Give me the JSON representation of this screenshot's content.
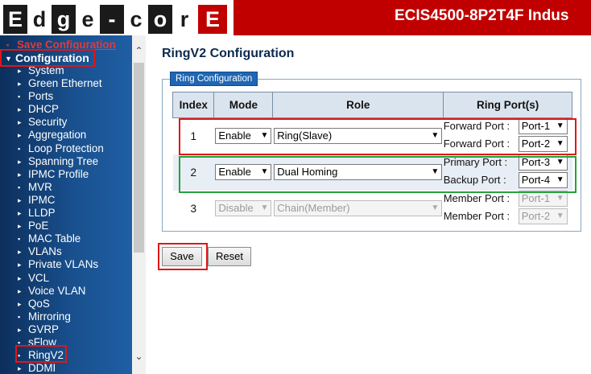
{
  "header": {
    "logo_letters": [
      "E",
      "d",
      "g",
      "e",
      "-",
      "c",
      "o",
      "r",
      "E"
    ],
    "device_title": "ECIS4500-8P2T4F Indus"
  },
  "sidebar": {
    "save_configuration": "Save Configuration",
    "configuration": "Configuration",
    "items": [
      {
        "label": "System",
        "marker": "▸"
      },
      {
        "label": "Green Ethernet",
        "marker": "▸"
      },
      {
        "label": "Ports",
        "marker": "▪"
      },
      {
        "label": "DHCP",
        "marker": "▸"
      },
      {
        "label": "Security",
        "marker": "▸"
      },
      {
        "label": "Aggregation",
        "marker": "▸"
      },
      {
        "label": "Loop Protection",
        "marker": "▪"
      },
      {
        "label": "Spanning Tree",
        "marker": "▸"
      },
      {
        "label": "IPMC Profile",
        "marker": "▸"
      },
      {
        "label": "MVR",
        "marker": "▪"
      },
      {
        "label": "IPMC",
        "marker": "▸"
      },
      {
        "label": "LLDP",
        "marker": "▸"
      },
      {
        "label": "PoE",
        "marker": "▸"
      },
      {
        "label": "MAC Table",
        "marker": "▪"
      },
      {
        "label": "VLANs",
        "marker": "▸"
      },
      {
        "label": "Private VLANs",
        "marker": "▸"
      },
      {
        "label": "VCL",
        "marker": "▸"
      },
      {
        "label": "Voice VLAN",
        "marker": "▸"
      },
      {
        "label": "QoS",
        "marker": "▸"
      },
      {
        "label": "Mirroring",
        "marker": "▪"
      },
      {
        "label": "GVRP",
        "marker": "▸"
      },
      {
        "label": "sFlow",
        "marker": "▪"
      },
      {
        "label": "RingV2",
        "marker": "▪"
      },
      {
        "label": "DDMI",
        "marker": "▸"
      }
    ]
  },
  "main": {
    "title": "RingV2 Configuration",
    "legend": "Ring Configuration",
    "columns": [
      "Index",
      "Mode",
      "Role",
      "Ring Port(s)"
    ],
    "rows": [
      {
        "index": "1",
        "mode": "Enable",
        "role": "Ring(Slave)",
        "port1_label": "Forward Port :",
        "port1": "Port-1",
        "port2_label": "Forward Port :",
        "port2": "Port-2",
        "disabled": false
      },
      {
        "index": "2",
        "mode": "Enable",
        "role": "Dual Homing",
        "port1_label": "Primary Port :",
        "port1": "Port-3",
        "port2_label": "Backup Port :",
        "port2": "Port-4",
        "disabled": false
      },
      {
        "index": "3",
        "mode": "Disable",
        "role": "Chain(Member)",
        "port1_label": "Member Port :",
        "port1": "Port-1",
        "port2_label": "Member Port :",
        "port2": "Port-2",
        "disabled": true
      }
    ],
    "save_label": "Save",
    "reset_label": "Reset"
  }
}
